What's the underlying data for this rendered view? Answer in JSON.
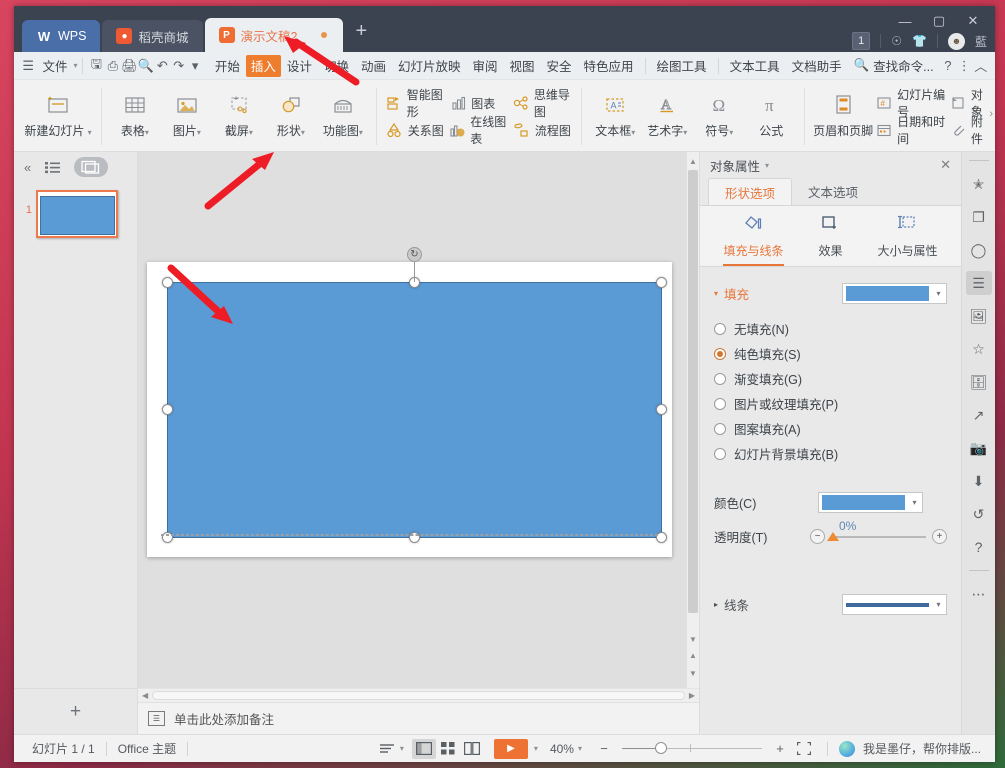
{
  "window": {
    "tabs": [
      {
        "label": "WPS",
        "icon": "wps-logo-icon"
      },
      {
        "label": "稻壳商城",
        "icon": "mall-icon"
      },
      {
        "label": "演示文稿2",
        "icon": "ppt-file-icon"
      }
    ],
    "add_tab_label": "+",
    "controls": {
      "minimize": "—",
      "maximize": "▢",
      "close": "✕"
    },
    "tray": {
      "count": "1",
      "user_label": "藍"
    }
  },
  "menubar": {
    "file_label": "文件",
    "quick_icons": [
      "save-icon",
      "print-preview-icon",
      "print-icon",
      "find-icon",
      "undo-icon",
      "redo-icon",
      "customize-icon"
    ],
    "tabs": [
      {
        "label": "开始",
        "active": false
      },
      {
        "label": "插入",
        "active": true
      },
      {
        "label": "设计",
        "active": false
      },
      {
        "label": "切换",
        "active": false
      },
      {
        "label": "动画",
        "active": false
      },
      {
        "label": "幻灯片放映",
        "active": false
      },
      {
        "label": "审阅",
        "active": false
      },
      {
        "label": "视图",
        "active": false
      },
      {
        "label": "安全",
        "active": false
      },
      {
        "label": "特色应用",
        "active": false
      },
      {
        "label": "绘图工具",
        "active": false
      },
      {
        "label": "文本工具",
        "active": false
      },
      {
        "label": "文档助手",
        "active": false
      }
    ],
    "search_label": "查找命令...",
    "help_label": "?",
    "more_label": "⋮",
    "collapse_label": "︿"
  },
  "ribbon": {
    "new_slide": "新建幻灯片",
    "group1": [
      {
        "label": "表格",
        "icon": "table-icon"
      },
      {
        "label": "图片",
        "icon": "picture-icon"
      },
      {
        "label": "截屏",
        "icon": "screenshot-icon"
      },
      {
        "label": "形状",
        "icon": "shapes-icon"
      },
      {
        "label": "功能图",
        "icon": "function-chart-icon"
      }
    ],
    "group2": [
      {
        "label": "智能图形",
        "icon": "smartart-icon"
      },
      {
        "label": "关系图",
        "icon": "relationship-icon"
      },
      {
        "label": "图表",
        "icon": "chart-icon"
      },
      {
        "label": "在线图表",
        "icon": "online-chart-icon"
      },
      {
        "label": "思维导图",
        "icon": "mindmap-icon"
      },
      {
        "label": "流程图",
        "icon": "flowchart-icon"
      }
    ],
    "group3": [
      {
        "label": "文本框",
        "icon": "textbox-icon"
      },
      {
        "label": "艺术字",
        "icon": "wordart-icon"
      },
      {
        "label": "符号",
        "icon": "symbol-icon"
      },
      {
        "label": "公式",
        "icon": "formula-icon"
      }
    ],
    "group4": [
      {
        "label": "页眉和页脚",
        "icon": "header-footer-icon"
      }
    ],
    "group5": [
      {
        "label": "幻灯片编号",
        "icon": "slide-number-icon"
      },
      {
        "label": "日期和时间",
        "icon": "date-time-icon"
      },
      {
        "label": "对象",
        "icon": "object-icon"
      },
      {
        "label": "附件",
        "icon": "attachment-icon"
      }
    ]
  },
  "thumbnails": {
    "outline_icon": "outline-view-icon",
    "slides_icon": "slides-view-icon",
    "collapse_icon": "collapse-pane-icon",
    "items": [
      {
        "number": "1"
      }
    ],
    "add_slide_label": "+"
  },
  "notes": {
    "placeholder": "单击此处添加备注"
  },
  "properties": {
    "title": "对象属性",
    "close_label": "✕",
    "tabs": [
      {
        "label": "形状选项",
        "active": true
      },
      {
        "label": "文本选项",
        "active": false
      }
    ],
    "subtabs": [
      {
        "label": "填充与线条",
        "icon": "fill-line-icon",
        "active": true
      },
      {
        "label": "效果",
        "icon": "effects-icon",
        "active": false
      },
      {
        "label": "大小与属性",
        "icon": "size-properties-icon",
        "active": false
      }
    ],
    "fill_section": {
      "title": "填充",
      "swatch_color": "#5b9bd5",
      "options": [
        {
          "label": "无填充(N)",
          "key": "N",
          "selected": false
        },
        {
          "label": "纯色填充(S)",
          "key": "S",
          "selected": true
        },
        {
          "label": "渐变填充(G)",
          "key": "G",
          "selected": false
        },
        {
          "label": "图片或纹理填充(P)",
          "key": "P",
          "selected": false
        },
        {
          "label": "图案填充(A)",
          "key": "A",
          "selected": false
        },
        {
          "label": "幻灯片背景填充(B)",
          "key": "B",
          "selected": false
        }
      ],
      "color_label": "颜色(C)",
      "color_value": "#5b9bd5",
      "transparency_label": "透明度(T)",
      "transparency_value": "0%"
    },
    "line_section": {
      "title": "线条",
      "line_color": "#41699b"
    }
  },
  "vtoolbar": {
    "items": [
      {
        "icon": "ai-magic-icon"
      },
      {
        "icon": "layers-icon"
      },
      {
        "icon": "shape-tools-icon"
      },
      {
        "icon": "properties-icon",
        "active": true
      },
      {
        "icon": "image-library-icon"
      },
      {
        "icon": "favorites-star-icon"
      },
      {
        "icon": "archive-icon"
      },
      {
        "icon": "share-export-icon"
      },
      {
        "icon": "picture-insert-icon"
      },
      {
        "icon": "download-icon"
      },
      {
        "icon": "history-icon"
      },
      {
        "icon": "help-circle-icon"
      },
      {
        "icon": "more-dots-icon"
      }
    ]
  },
  "statusbar": {
    "slide_count": "幻灯片 1 / 1",
    "theme": "Office 主题",
    "view_icons": [
      "reading-lines-icon",
      "normal-view-icon",
      "slide-sorter-icon",
      "reading-view-icon"
    ],
    "play_label": "▶",
    "zoom_level": "40%",
    "zoom_out": "−",
    "zoom_in": "+",
    "fit_icon": "fit-to-window-icon",
    "ai_label": "我是墨仔，帮你排版..."
  },
  "annotations": {
    "arrow1_target": "插入",
    "arrow2_target": "形状",
    "arrow3_target": "slide-shape"
  }
}
